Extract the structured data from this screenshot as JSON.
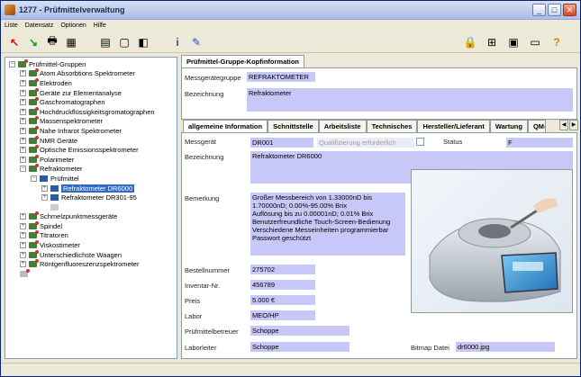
{
  "window": {
    "title": "1277 - Prüfmittelverwaltung"
  },
  "menu": [
    "Liste",
    "Datensatz",
    "Optionen",
    "Hilfe"
  ],
  "tree": {
    "root": "Prüfmittel-Gruppen",
    "items": [
      {
        "label": "Atom Absorbtions Spektrometer"
      },
      {
        "label": "Elektroden"
      },
      {
        "label": "Geräte zur Elementanalyse"
      },
      {
        "label": "Gaschromatographen"
      },
      {
        "label": "Hochdruckflüssigkeitsgromatographen"
      },
      {
        "label": "Massenspektrometer"
      },
      {
        "label": "Nahe Infrarot Spektrometer"
      },
      {
        "label": "NMR Geräte"
      },
      {
        "label": "Optische Emissionsspektrometer"
      },
      {
        "label": "Polarimeter"
      },
      {
        "label": "Refraktometer"
      }
    ],
    "sub_group": "Prüfmittel",
    "sub_items": [
      "Refraktometer DR6000",
      "Refraktometer DR301-95"
    ],
    "after_items": [
      {
        "label": "Schmelzpunktmessgeräte"
      },
      {
        "label": "Spindel"
      },
      {
        "label": "Titratoren"
      },
      {
        "label": "Viskostimeter"
      },
      {
        "label": "Unterschiedlichste Waagen"
      },
      {
        "label": "Röntgenfluoreszenzspektrometer"
      }
    ]
  },
  "top_tab": "Prüfmittel-Gruppe-Kopfinformation",
  "group": {
    "label_group": "Messgerätegruppe",
    "value_group": "REFRAKTOMETER",
    "label_name": "Bezeichnung",
    "value_name": "Refraktometer"
  },
  "tabs": [
    "allgemeine Information",
    "Schnittstelle",
    "Arbeitsliste",
    "Technisches",
    "Hersteller/Lieferant",
    "Wartung",
    "QM-In"
  ],
  "info": {
    "label_device": "Messgerät",
    "value_device": "DR001",
    "qualification": "Qualifizierung erforderlich",
    "label_status": "Status",
    "value_status": "F",
    "label_name": "Bezeichnung",
    "value_name": "Refraktometer DR6000",
    "label_remark": "Bemerkung",
    "value_remark": "Großer Messbereich von 1.33000nD bis\n1.70000nD; 0.00%-95.00% Brix\nAuflösung bis zu 0.00001nD; 0.01% Brix\nBenutzerfreundliche Touch-Screen-Bedienung\nVerschiedene Messeinheiten programmierbar\nPasswort geschützt",
    "label_order": "Bestellnummer",
    "value_order": "275702",
    "label_inventory": "Inventar-Nr.",
    "value_inventory": "456789",
    "label_price": "Preis",
    "value_price": "5.000 €",
    "label_lab": "Labor",
    "value_lab": "MEO/HP",
    "label_caretaker": "Prüfmittelbetreuer",
    "value_caretaker": "Schoppe",
    "label_head": "Laborleiter",
    "value_head": "Schoppe",
    "label_bitmap": "Bitmap Datei",
    "value_bitmap": "dr6000.jpg"
  }
}
